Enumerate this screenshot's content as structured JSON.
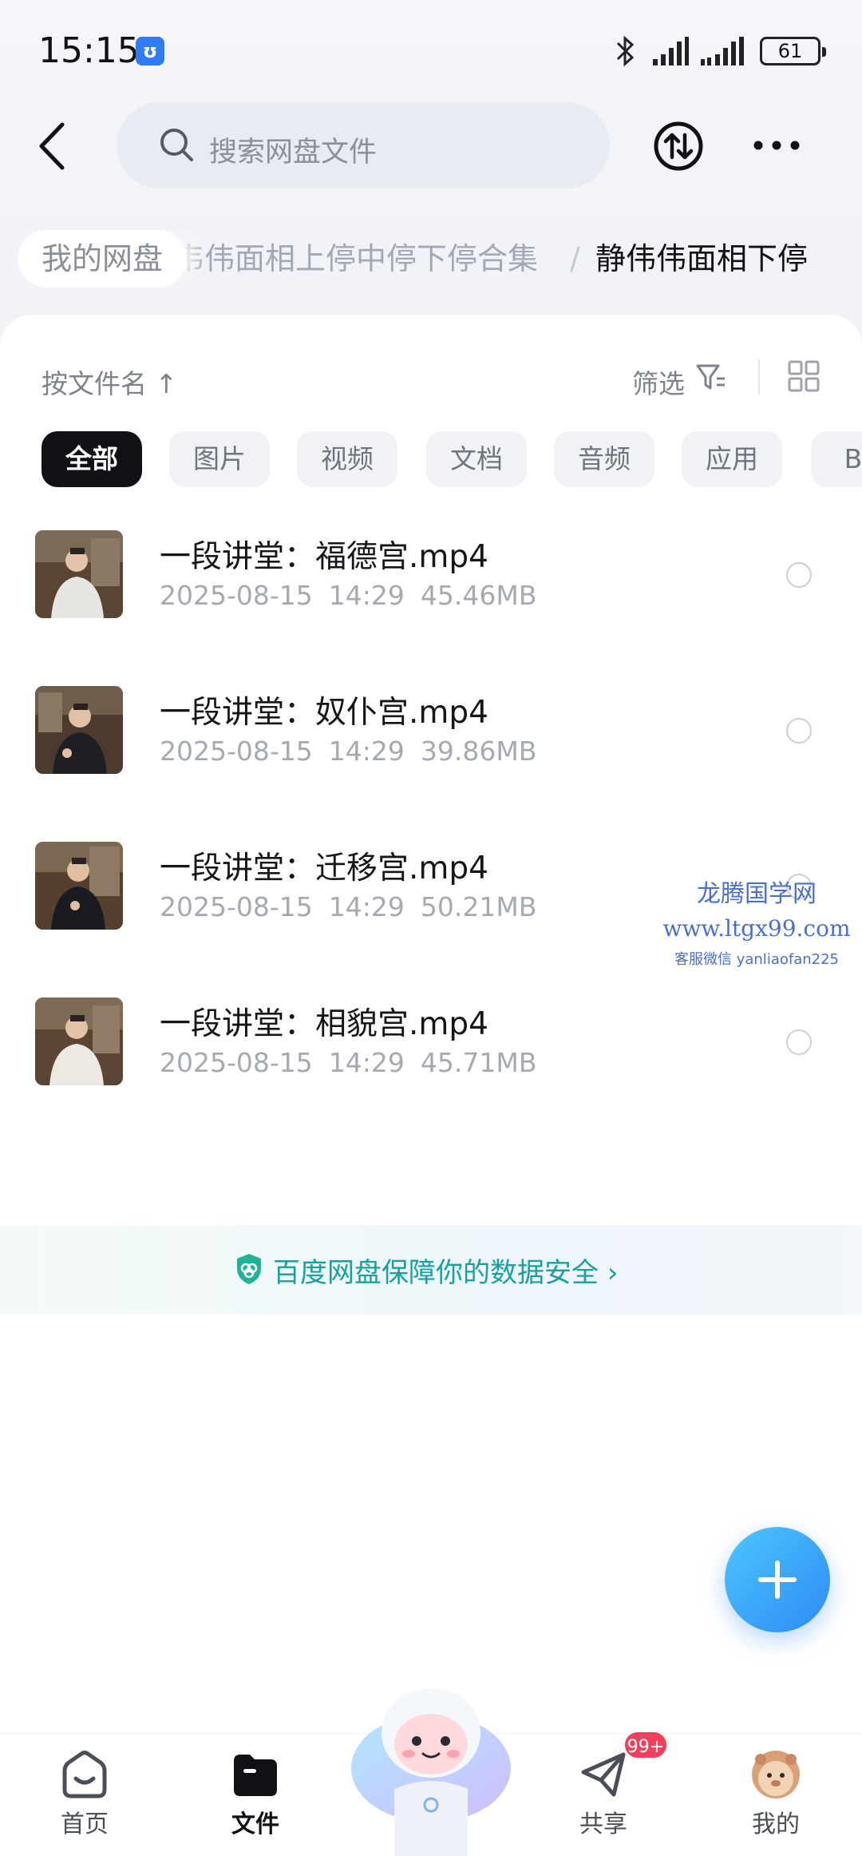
{
  "status_bar": {
    "time": "15:15",
    "battery": "61"
  },
  "header": {
    "search_placeholder": "搜索网盘文件"
  },
  "breadcrumb": {
    "root": "我的网盘",
    "middle": "韦伟面相上停中停下停合集",
    "separator": "/",
    "current": "静伟伟面相下停"
  },
  "toolbar": {
    "sort_label": "按文件名",
    "sort_arrow": "↑",
    "filter_label": "筛选"
  },
  "chips": [
    {
      "label": "全部",
      "active": true
    },
    {
      "label": "图片",
      "active": false
    },
    {
      "label": "视频",
      "active": false
    },
    {
      "label": "文档",
      "active": false
    },
    {
      "label": "音频",
      "active": false
    },
    {
      "label": "应用",
      "active": false
    },
    {
      "label": "BT",
      "active": false
    }
  ],
  "files": [
    {
      "name": "一段讲堂：福德宫.mp4",
      "date": "2025-08-15",
      "time": "14:29",
      "size": "45.46MB"
    },
    {
      "name": "一段讲堂：奴仆宫.mp4",
      "date": "2025-08-15",
      "time": "14:29",
      "size": "39.86MB"
    },
    {
      "name": "一段讲堂：迁移宫.mp4",
      "date": "2025-08-15",
      "time": "14:29",
      "size": "50.21MB"
    },
    {
      "name": "一段讲堂：相貌宫.mp4",
      "date": "2025-08-15",
      "time": "14:29",
      "size": "45.71MB"
    }
  ],
  "security": {
    "text": "百度网盘保障你的数据安全",
    "chevron": "›"
  },
  "watermark": {
    "title": "龙腾国学网",
    "url": "www.ltgx99.com",
    "contact": "客服微信 yanliaofan225"
  },
  "bottom_nav": {
    "home": "首页",
    "files": "文件",
    "share": "共享",
    "share_badge": "99+",
    "me": "我的"
  },
  "colors": {
    "accent": "#2d8bf5",
    "security_text": "#17a0a0",
    "badge": "#f2405a"
  }
}
